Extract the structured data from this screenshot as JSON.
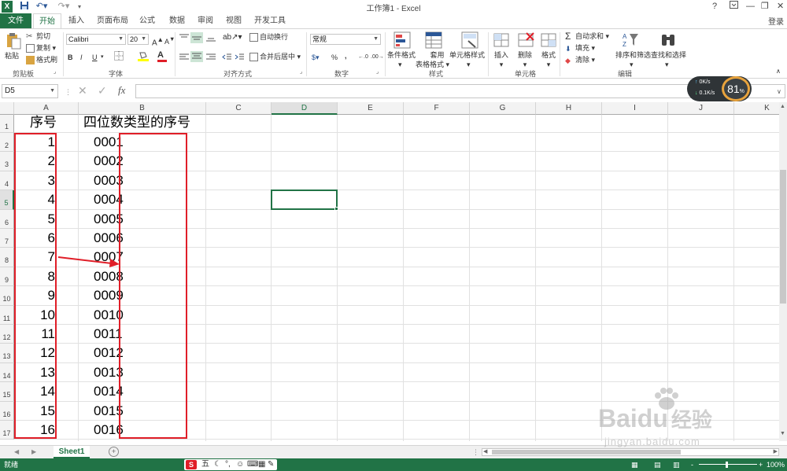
{
  "title_bar": {
    "title": "工作簿1 - Excel",
    "help": "?",
    "restore_icon": "ribbon-display-icon",
    "minimize": "—",
    "maximize": "❐",
    "close": "✕"
  },
  "tabs": [
    "文件",
    "开始",
    "插入",
    "页面布局",
    "公式",
    "数据",
    "审阅",
    "视图",
    "开发工具"
  ],
  "login": "登录",
  "ribbon": {
    "clipboard": {
      "paste": "粘贴",
      "cut": "剪切",
      "copy": "复制",
      "format_painter": "格式刷",
      "label": "剪贴板"
    },
    "font": {
      "name": "Calibri",
      "size": "20",
      "label": "字体",
      "bold": "B",
      "italic": "I",
      "underline": "U"
    },
    "alignment": {
      "wrap": "自动换行",
      "merge": "合并后居中",
      "label": "对齐方式"
    },
    "number": {
      "format": "常规",
      "percent": "%",
      "comma": ",",
      "label": "数字"
    },
    "styles": {
      "conditional": "条件格式",
      "table_1": "套用",
      "table_2": "表格格式",
      "cell_styles": "单元格样式",
      "label": "样式"
    },
    "cells": {
      "insert": "插入",
      "delete": "删除",
      "format": "格式",
      "label": "单元格"
    },
    "editing": {
      "autosum": "自动求和",
      "fill": "填充",
      "clear": "清除",
      "sort_filter": "排序和筛选",
      "find_select": "查找和选择",
      "label": "编辑"
    }
  },
  "formula_bar": {
    "name_box": "D5",
    "fx": "fx",
    "content": ""
  },
  "columns": [
    "A",
    "B",
    "C",
    "D",
    "E",
    "F",
    "G",
    "H",
    "I",
    "J",
    "K"
  ],
  "rows": [
    "1",
    "2",
    "3",
    "4",
    "5",
    "6",
    "7",
    "8",
    "9",
    "10",
    "11",
    "12",
    "13",
    "14",
    "15",
    "16",
    "17"
  ],
  "selected_cell": "D5",
  "cells": {
    "A1": "序号",
    "B1": "四位数类型的序号",
    "A": [
      "1",
      "2",
      "3",
      "4",
      "5",
      "6",
      "7",
      "8",
      "9",
      "10",
      "11",
      "12",
      "13",
      "14",
      "15",
      "16"
    ],
    "B": [
      "0001",
      "0002",
      "0003",
      "0004",
      "0005",
      "0006",
      "0007",
      "0008",
      "0009",
      "0010",
      "0011",
      "0012",
      "0013",
      "0014",
      "0015",
      "0016"
    ]
  },
  "annotation": {
    "color": "#e01e28"
  },
  "sheet_tabs": [
    "Sheet1"
  ],
  "add_sheet": "+",
  "status": {
    "ready": "就绪",
    "zoom": "100%",
    "zoom_minus": "-",
    "zoom_plus": "+"
  },
  "ime_toolbar": [
    "五"
  ],
  "speed_widget": {
    "up": "0K/s",
    "down": "0.1K/s",
    "percent": "81",
    "percent_sign": "%"
  },
  "watermark": {
    "brand": "Baidu",
    "suffix": "经验",
    "url": "jingyan.baidu.com"
  },
  "colors": {
    "accent": "#217346",
    "red": "#e01e28"
  }
}
